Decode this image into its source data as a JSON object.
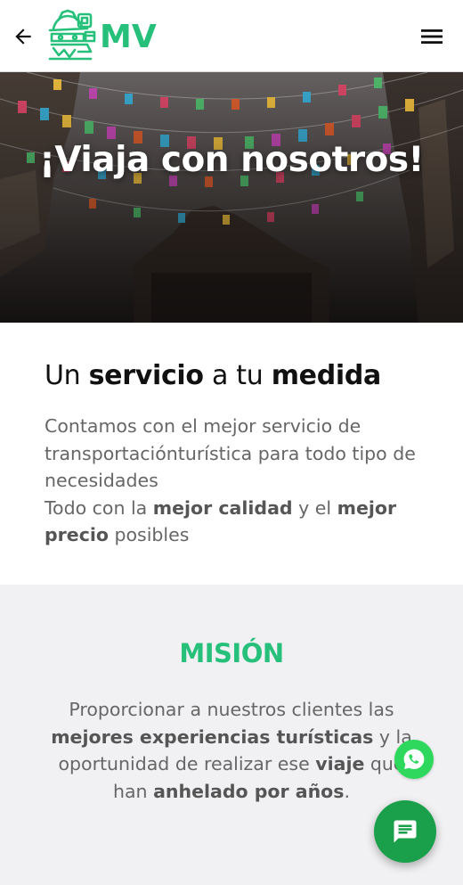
{
  "header": {
    "logo_text": "MV",
    "back_icon": "arrow-left-icon",
    "menu_icon": "hamburger-menu-icon",
    "logo_icon": "aztec-sombrero-head-logo"
  },
  "hero": {
    "title": "¡Viaja con nosotros!"
  },
  "service": {
    "title_part1": "Un ",
    "title_bold1": "servicio",
    "title_part2": " a tu ",
    "title_bold2": "medida",
    "body_part1": "Contamos con el mejor servicio de transportaciónturística para todo tipo de necesidades",
    "body_part2": "Todo con la ",
    "body_bold1": "mejor calidad",
    "body_part3": " y el ",
    "body_bold2": "mejor precio",
    "body_part4": " posibles"
  },
  "mision": {
    "title": "MISIÓN",
    "body_part1": "Proporcionar a nuestros clientes las ",
    "body_bold1": "mejores experiencias turísticas",
    "body_part2": " y la oportunidad de realizar ese ",
    "body_bold2": "viaje",
    "body_part3": " que han ",
    "body_bold3": "anhelado por años",
    "body_part4": "."
  },
  "colors": {
    "brand_green": "#27c07a",
    "fab_green": "#1aa04a",
    "whatsapp_green": "#2dd85c"
  }
}
